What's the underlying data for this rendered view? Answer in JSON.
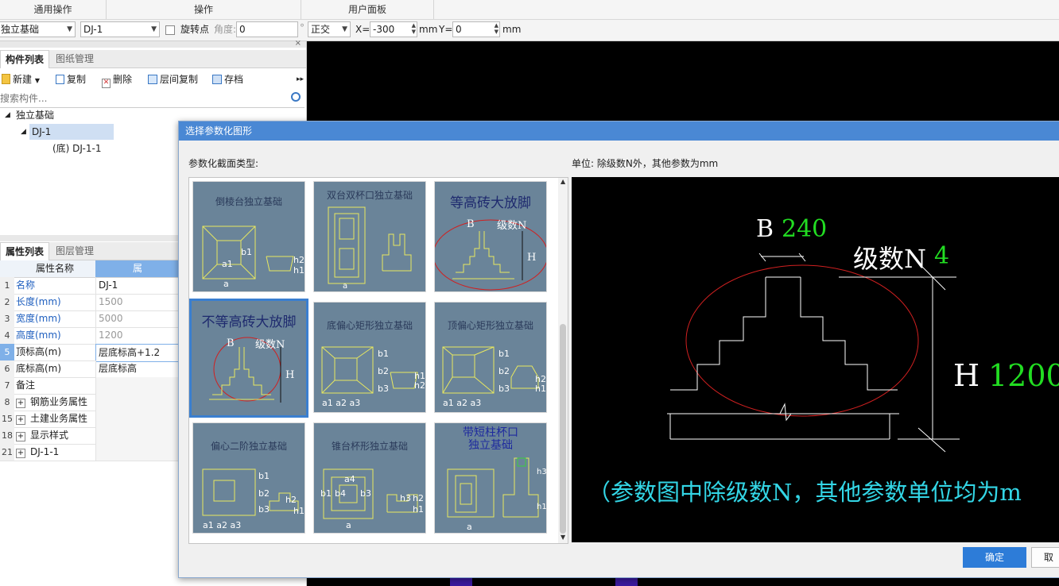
{
  "ribbon": {
    "groups": [
      "通用操作",
      "操作",
      "用户面板"
    ]
  },
  "optionbar": {
    "type_value": "独立基础",
    "component_value": "DJ-1",
    "rotate_label": "旋转点",
    "angle_label": "角度:",
    "angle_value": "0",
    "degree_symbol": "°",
    "mode_value": "正交",
    "x_label": "X=",
    "x_value": "-300",
    "x_unit": "mm",
    "y_label": "Y=",
    "y_value": "0",
    "y_unit": "mm"
  },
  "component_panel": {
    "tabs": [
      "构件列表",
      "图纸管理"
    ],
    "toolbar": {
      "new": "新建",
      "copy": "复制",
      "delete": "删除",
      "floor_copy": "层间复制",
      "archive": "存档"
    },
    "search_placeholder": "搜索构件...",
    "tree": {
      "root": "独立基础",
      "child": "DJ-1",
      "leaf": "(底)  DJ-1-1"
    }
  },
  "property_panel": {
    "tabs": [
      "属性列表",
      "图层管理"
    ],
    "header_name": "属性名称",
    "header_value": "属",
    "rows": [
      {
        "num": "1",
        "name": "名称",
        "value": "DJ-1"
      },
      {
        "num": "2",
        "name": "长度(mm)",
        "value": "1500"
      },
      {
        "num": "3",
        "name": "宽度(mm)",
        "value": "5000"
      },
      {
        "num": "4",
        "name": "高度(mm)",
        "value": "1200"
      },
      {
        "num": "5",
        "name": "顶标高(m)",
        "value": "层底标高+1.2"
      },
      {
        "num": "6",
        "name": "底标高(m)",
        "value": "层底标高"
      },
      {
        "num": "7",
        "name": "备注",
        "value": ""
      },
      {
        "num": "8",
        "name": "钢筋业务属性",
        "value": ""
      },
      {
        "num": "15",
        "name": "土建业务属性",
        "value": ""
      },
      {
        "num": "18",
        "name": "显示样式",
        "value": ""
      },
      {
        "num": "21",
        "name": "DJ-1-1",
        "value": ""
      }
    ]
  },
  "dialog": {
    "title": "选择参数化图形",
    "type_label": "参数化截面类型:",
    "unit_label": "单位:   除级数N外，其他参数为mm",
    "thumbnails": [
      "倒棱台独立基础",
      "双台双杯口独立基础",
      "等高砖大放脚",
      "不等高砖大放脚",
      "底偏心矩形独立基础",
      "顶偏心矩形独立基础",
      "偏心二阶独立基础",
      "锥台杯形独立基础",
      "带短柱杯口独立基础"
    ],
    "thumb_labels": {
      "B": "B",
      "N": "级数N",
      "H": "H",
      "a": "a",
      "a1": "a1",
      "b1": "b1",
      "h1": "h1",
      "h2": "h2",
      "a2": "a2",
      "a3": "a3",
      "b2": "b2",
      "b3": "b3",
      "b4": "b4",
      "a4": "a4",
      "h3": "h3"
    },
    "preview": {
      "B_label": "B",
      "B_value": "240",
      "N_label": "级数N",
      "N_value": "4",
      "H_label": "H",
      "H_value": "1200",
      "note": "（参数图中除级数N，其他参数单位均为m"
    },
    "ok_button": "确定",
    "cancel_button": "取"
  },
  "colors": {
    "accent": "#2d7cd8",
    "title_bar": "#4a88d4",
    "preview_green": "#22dd22",
    "preview_cyan": "#33d6e6",
    "circle_red": "#d02020"
  }
}
